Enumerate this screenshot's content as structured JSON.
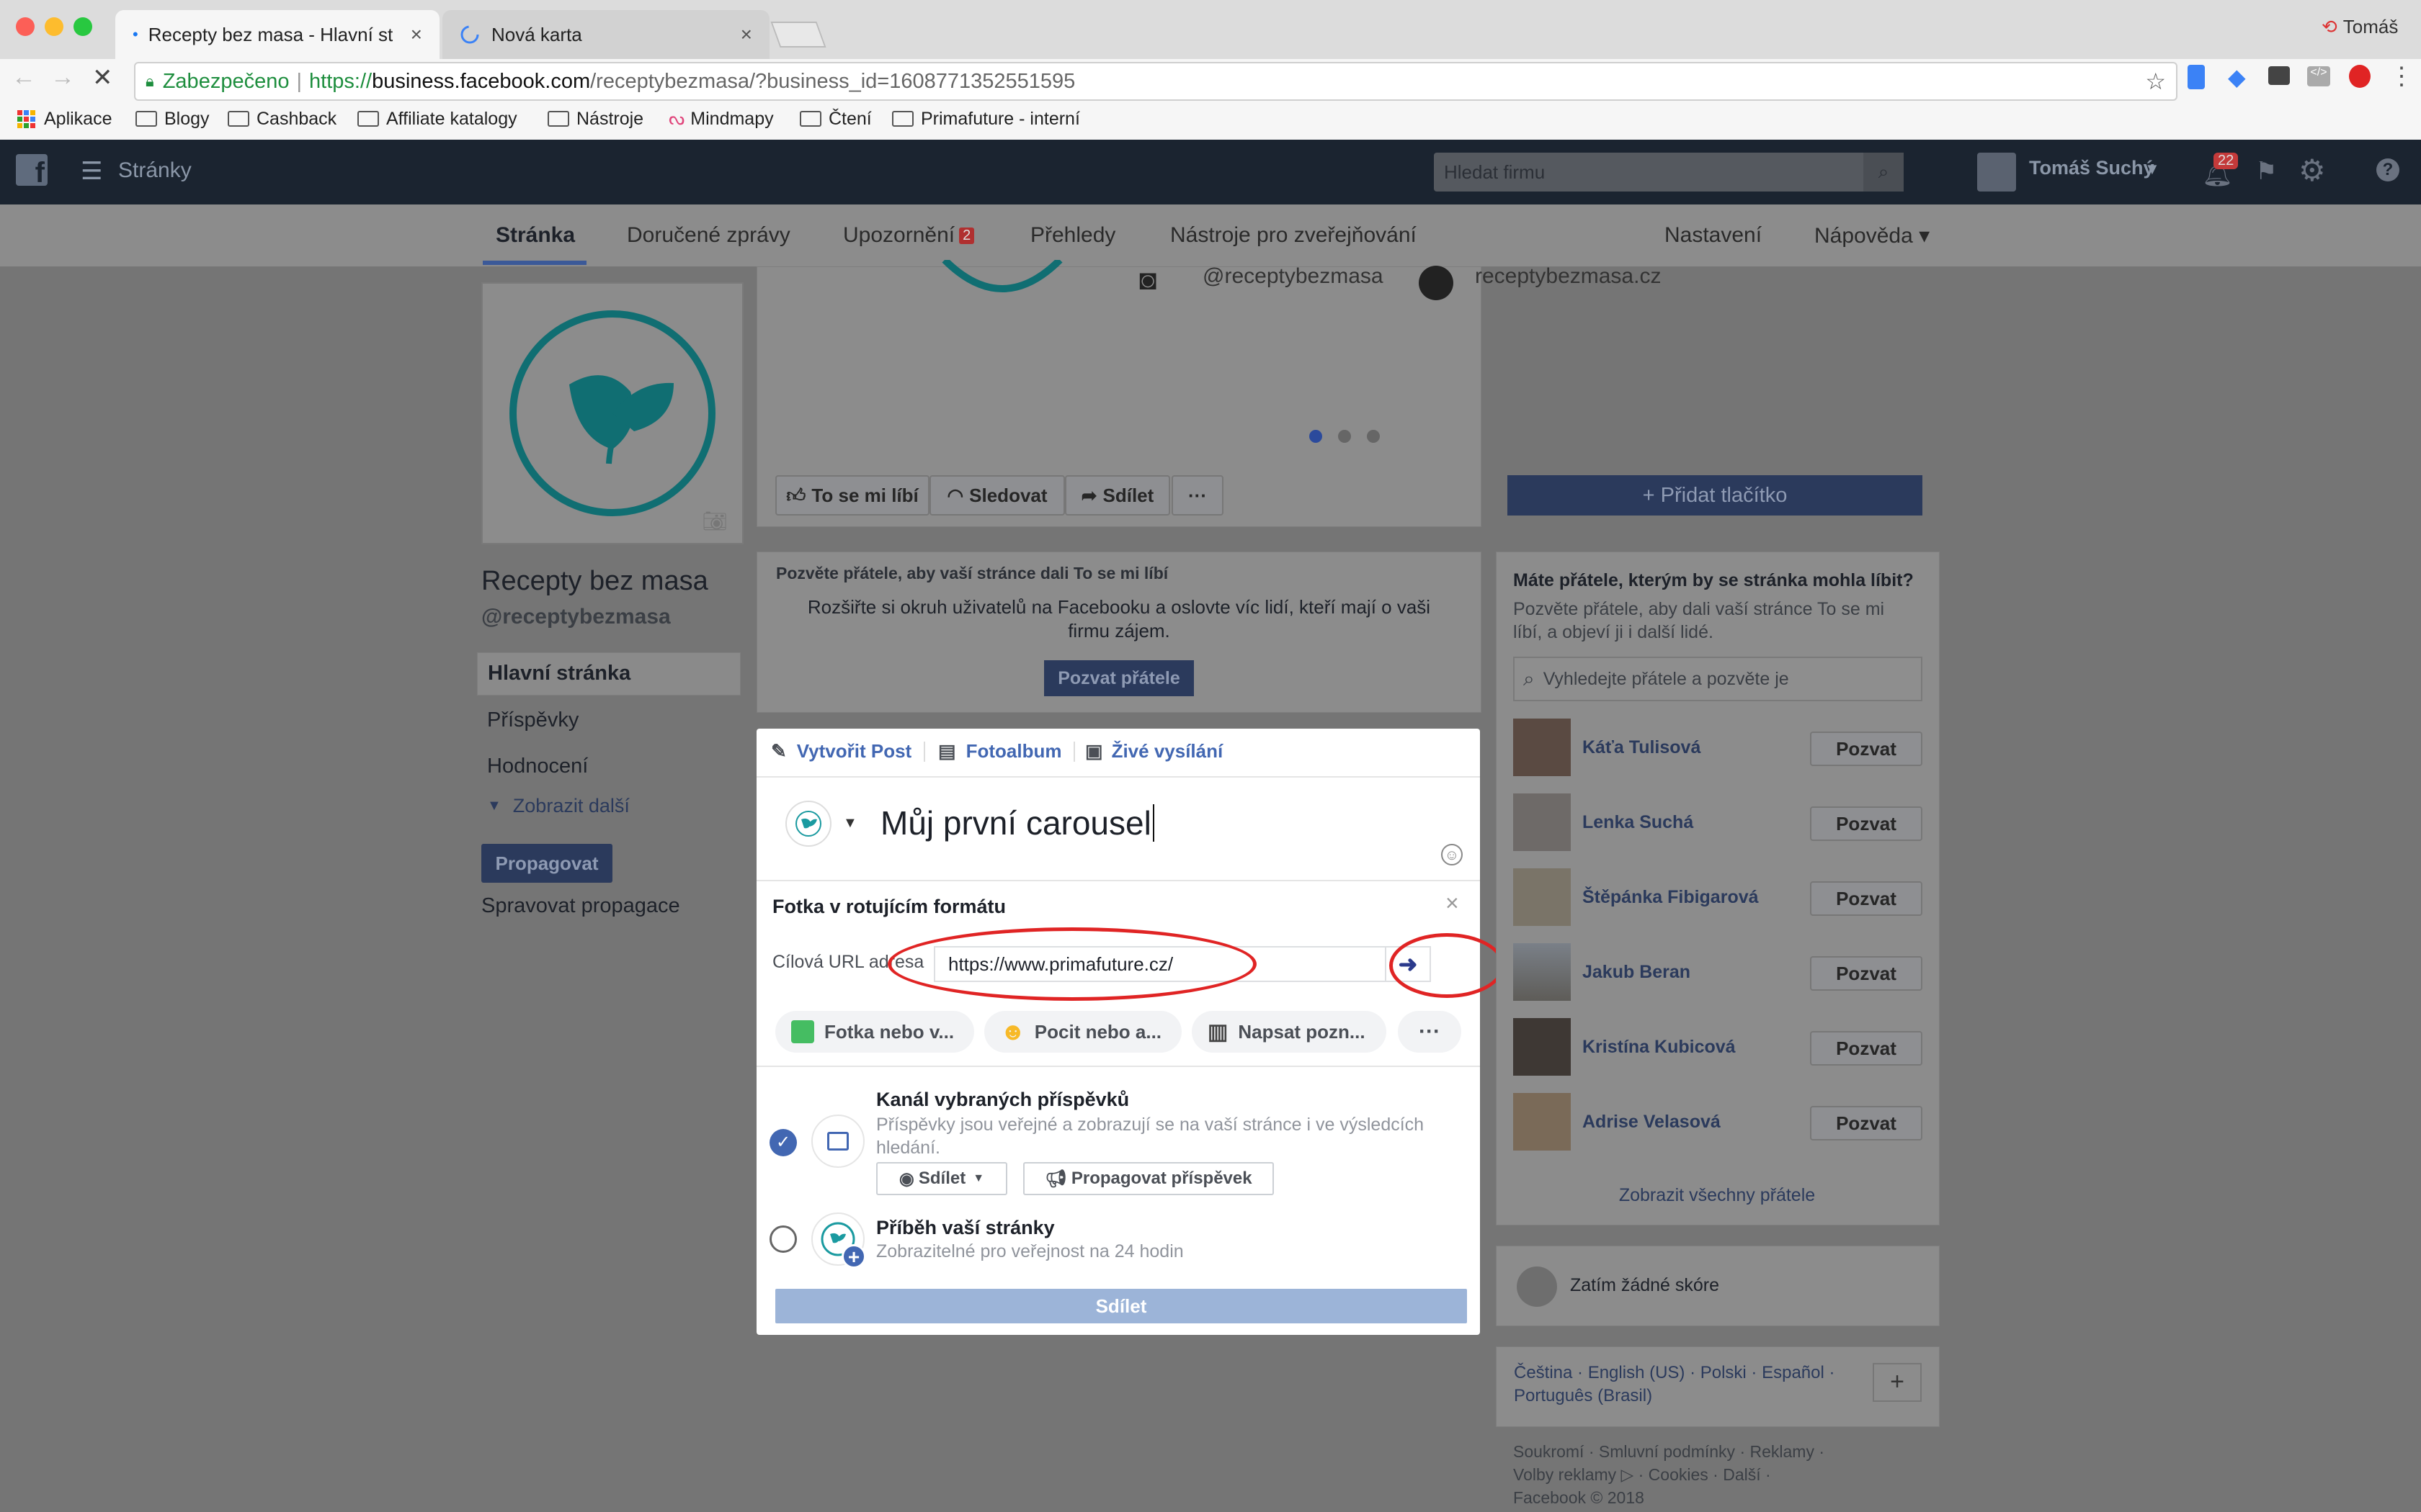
{
  "browser": {
    "tabs": [
      {
        "title": "Recepty bez masa - Hlavní stránka",
        "close": "×"
      },
      {
        "title": "Nová karta",
        "close": "×"
      }
    ],
    "profile": "Tomáš",
    "secure_label": "Zabezpečeno",
    "url_prefix": "https://",
    "url_host": "business.facebook.com",
    "url_path": "/receptybezmasa/?business_id=1608771352551595",
    "bookmarks": [
      "Aplikace",
      "Blogy",
      "Cashback",
      "Affiliate katalogy",
      "Nástroje",
      "Mindmapy",
      "Čtení",
      "Primafuture - interní"
    ]
  },
  "fb_header": {
    "section": "Stránky",
    "search_placeholder": "Hledat firmu",
    "user": "Tomáš Suchý",
    "notifications": "22"
  },
  "page_tabs": {
    "items": [
      "Stránka",
      "Doručené zprávy",
      "Upozornění",
      "Přehledy",
      "Nástroje pro zveřejňování"
    ],
    "upozorneni_badge": "2",
    "right": [
      "Nastavení",
      "Nápověda ▾"
    ]
  },
  "sidebar": {
    "page_name": "Recepty bez masa",
    "handle": "@receptybezmasa",
    "nav": [
      "Hlavní stránka",
      "Příspěvky",
      "Hodnocení"
    ],
    "more": "Zobrazit další",
    "promote": "Propagovat",
    "manage_promos": "Spravovat propagace"
  },
  "cover": {
    "instagram": "@receptybezmasa",
    "website": "receptybezmasa.cz"
  },
  "actions": {
    "like": "To se mi líbí",
    "follow": "Sledovat",
    "share": "Sdílet",
    "more": "···",
    "add_button": "+ Přidat tlačítko"
  },
  "invite_box": {
    "title": "Pozvěte přátele, aby vaší stránce dali To se mi líbí",
    "text": "Rozšiřte si okruh uživatelů na Facebooku a oslovte víc lidí, kteří mají o vaši firmu zájem.",
    "button": "Pozvat přátele"
  },
  "composer": {
    "tabs": [
      "Vytvořit Post",
      "Fotoalbum",
      "Živé vysílání"
    ],
    "text": "Můj první carousel",
    "carousel_title": "Fotka v rotujícím formátu",
    "url_label": "Cílová URL adresa",
    "url_value": "https://www.primafuture.cz/",
    "pills": [
      "Fotka nebo v...",
      "Pocit nebo a...",
      "Napsat pozn..."
    ],
    "pill_more": "···",
    "feed_title": "Kanál vybraných příspěvků",
    "feed_desc": "Příspěvky jsou veřejné a zobrazují se na vaší stránce i ve výsledcích hledání.",
    "share_dropdown": "Sdílet",
    "promote_post": "Propagovat příspěvek",
    "story_title": "Příběh vaší stránky",
    "story_desc": "Zobrazitelné pro veřejnost na 24 hodin",
    "submit": "Sdílet"
  },
  "friends_box": {
    "title": "Máte přátele, kterým by se stránka mohla líbit?",
    "subtitle": "Pozvěte přátele, aby dali vaší stránce To se mi líbí, a objeví ji i další lidé.",
    "search_placeholder": "Vyhledejte přátele a pozvěte je",
    "invite_label": "Pozvat",
    "friends": [
      "Káťa Tulisová",
      "Lenka Suchá",
      "Štěpánka Fibigarová",
      "Jakub Beran",
      "Kristína Kubicová",
      "Adrise Velasová"
    ],
    "show_all": "Zobrazit všechny přátele"
  },
  "score_box": {
    "text": "Zatím žádné skóre"
  },
  "languages": {
    "text": "Čeština · English (US) · Polski · Español · Português (Brasil)",
    "add": "+"
  },
  "footer": {
    "line1": "Soukromí · Smluvní podmínky · Reklamy ·",
    "line2": "Volby reklamy ▷ · Cookies · Další ·",
    "line3": "Facebook © 2018"
  },
  "colors": {
    "brand_blue": "#4267b2",
    "teal": "#1a9aa0",
    "highlight_red": "#e02424",
    "header": "#1b2430"
  }
}
